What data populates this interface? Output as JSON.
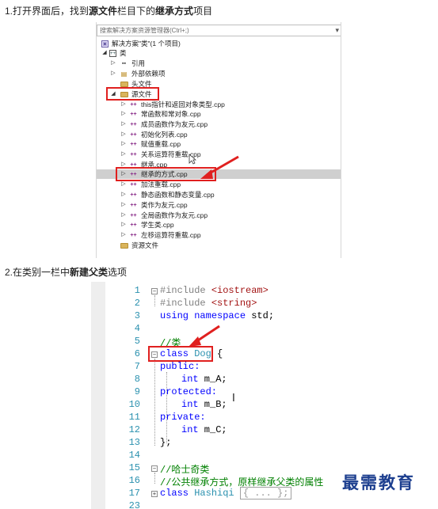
{
  "steps": {
    "step1": {
      "prefix": "1.打开界面后，找到",
      "b1": "源文件",
      "mid": "栏目下的",
      "b2": "继承方式",
      "suffix": "项目"
    },
    "step2": {
      "prefix": "2.在类别一栏中",
      "b1": "新建父类",
      "suffix": "选项"
    }
  },
  "solution_explorer": {
    "search_placeholder": "搜索解决方案资源管理器(Ctrl+;)",
    "solution_label": "解决方案\"类\"(1 个项目)",
    "project_label": "类",
    "references_label": "引用",
    "external_deps_label": "外部依赖项",
    "header_files_label": "头文件",
    "source_files_label": "源文件",
    "resource_files_label": "资源文件",
    "files": [
      "this指针和返回对象类型.cpp",
      "常函数和常对象.cpp",
      "成员函数作为友元.cpp",
      "初始化列表.cpp",
      "赋值重载.cpp",
      "关系运算符重载.cpp",
      "继承.cpp",
      "继承的方式.cpp",
      "加法重载.cpp",
      "静态函数和静态变量.cpp",
      "类作为友元.cpp",
      "全局函数作为友元.cpp",
      "学生类.cpp",
      "左移运算符重载.cpp"
    ],
    "selected_file": "继承的方式.cpp"
  },
  "code": {
    "line_numbers": [
      "1",
      "2",
      "3",
      "4",
      "5",
      "6",
      "7",
      "8",
      "9",
      "10",
      "11",
      "12",
      "13",
      "14",
      "15",
      "16",
      "17",
      "23"
    ],
    "l1_pp": "#include ",
    "l1_str": "<iostream>",
    "l2_pp": "#include ",
    "l2_str": "<string>",
    "l3_kw1": "using",
    "l3_kw2": "namespace",
    "l3_rest": " std;",
    "l5_cm": "//类",
    "l6_kw": "class",
    "l6_ty": "Dog",
    "l6_brace": "{",
    "l7_kw": "public:",
    "l8_kw": "int",
    "l8_rest": " m_A;",
    "l9_kw": "protected:",
    "l10_kw": "int",
    "l10_rest": " m_B;",
    "l11_kw": "private:",
    "l12_kw": "int",
    "l12_rest": " m_C;",
    "l13": "};",
    "l15_cm": "//哈士奇类",
    "l16_cm": "//公共继承方式，原样继承父类的属性",
    "l17_kw": "class",
    "l17_ty": "Hashiqi",
    "l17_collapsed": "{ ... };"
  },
  "watermark": "最需教育",
  "colors": {
    "highlight_red": "#e0201f",
    "keyword": "#0000ff",
    "type": "#2b91af",
    "comment": "#008000",
    "string": "#a31515"
  }
}
